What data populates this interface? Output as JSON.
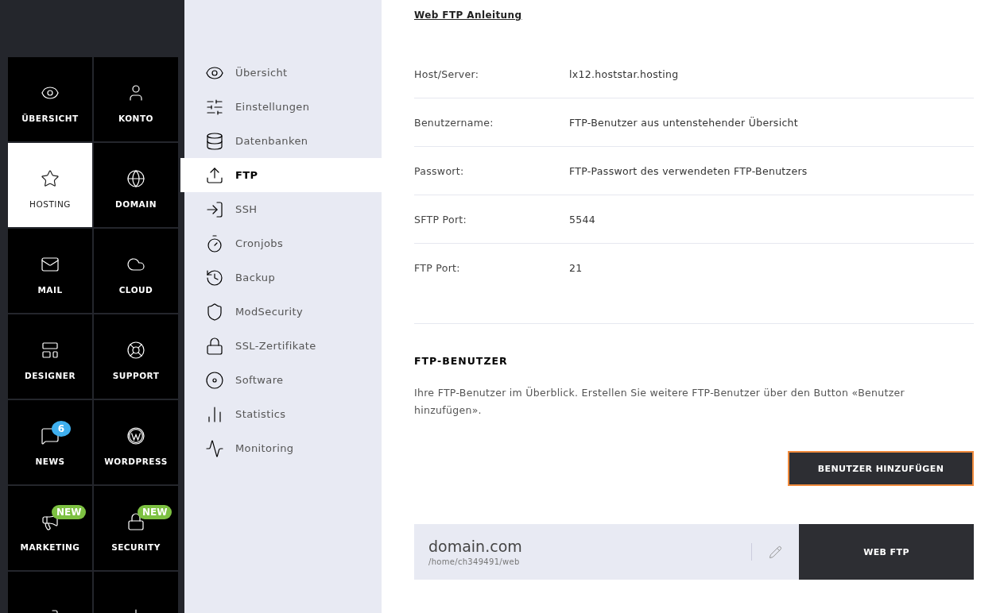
{
  "main_nav": [
    {
      "label": "ÜBERSICHT",
      "selected": false
    },
    {
      "label": "KONTO",
      "selected": false
    },
    {
      "label": "HOSTING",
      "selected": true
    },
    {
      "label": "DOMAIN",
      "selected": false
    },
    {
      "label": "MAIL",
      "selected": false
    },
    {
      "label": "CLOUD",
      "selected": false
    },
    {
      "label": "DESIGNER",
      "selected": false
    },
    {
      "label": "SUPPORT",
      "selected": false
    },
    {
      "label": "NEWS",
      "selected": false,
      "badge": {
        "text": "6",
        "kind": "count"
      }
    },
    {
      "label": "WORDPRESS",
      "selected": false
    },
    {
      "label": "MARKETING",
      "selected": false,
      "badge": {
        "text": "NEW",
        "kind": "new"
      }
    },
    {
      "label": "SECURITY",
      "selected": false,
      "badge": {
        "text": "NEW",
        "kind": "new"
      }
    },
    {
      "selected": false
    },
    {
      "selected": false
    }
  ],
  "sub_nav": [
    {
      "label": "Übersicht",
      "selected": false
    },
    {
      "label": "Einstellungen",
      "selected": false
    },
    {
      "label": "Datenbanken",
      "selected": false
    },
    {
      "label": "FTP",
      "selected": true
    },
    {
      "label": "SSH",
      "selected": false
    },
    {
      "label": "Cronjobs",
      "selected": false
    },
    {
      "label": "Backup",
      "selected": false
    },
    {
      "label": "ModSecurity",
      "selected": false
    },
    {
      "label": "SSL-Zertifikate",
      "selected": false
    },
    {
      "label": "Software",
      "selected": false
    },
    {
      "label": "Statistics",
      "selected": false
    },
    {
      "label": "Monitoring",
      "selected": false
    }
  ],
  "guide_link": "Web FTP Anleitung",
  "details": [
    {
      "label": "Host/Server:",
      "value": "lx12.hoststar.hosting"
    },
    {
      "label": "Benutzername:",
      "value": "FTP-Benutzer aus untenstehender Übersicht"
    },
    {
      "label": "Passwort:",
      "value": "FTP-Passwort des verwendeten FTP-Benutzers"
    },
    {
      "label": "SFTP Port:",
      "value": "5544"
    },
    {
      "label": "FTP Port:",
      "value": "21"
    }
  ],
  "ftp_users": {
    "title": "FTP-BENUTZER",
    "description": "Ihre FTP-Benutzer im Überblick. Erstellen Sie weitere FTP-Benutzer über den Button «Benutzer hinzufügen».",
    "add_button": "BENUTZER HINZUFÜGEN",
    "accounts": [
      {
        "domain": "domain.com",
        "path": "/home/ch349491/web",
        "button": "WEB FTP"
      }
    ]
  }
}
